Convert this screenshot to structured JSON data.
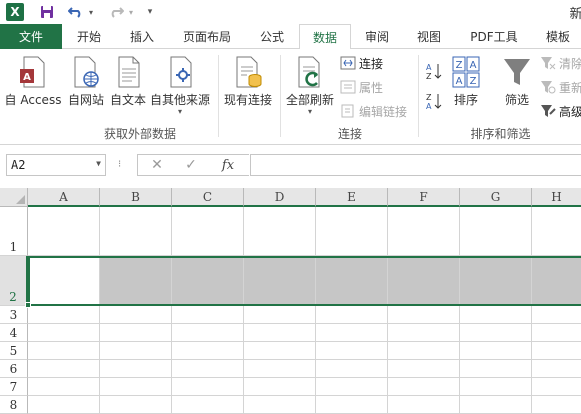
{
  "titlebar": {
    "app_logo": "X",
    "title_fragment": "新",
    "undo_dropdown": "▾",
    "redo_dropdown": "▾",
    "qat_customize": "▾"
  },
  "tabs": [
    {
      "label": "文件"
    },
    {
      "label": "开始"
    },
    {
      "label": "插入"
    },
    {
      "label": "页面布局"
    },
    {
      "label": "公式"
    },
    {
      "label": "数据"
    },
    {
      "label": "审阅"
    },
    {
      "label": "视图"
    },
    {
      "label": "PDF工具"
    },
    {
      "label": "模板"
    }
  ],
  "ribbon": {
    "external_data": {
      "group_label": "获取外部数据",
      "from_access": "自 Access",
      "from_web": "自网站",
      "from_text": "自文本",
      "from_other": "自其他来源",
      "existing_connections": "现有连接"
    },
    "connections": {
      "group_label": "连接",
      "refresh_all": "全部刷新",
      "connections": "连接",
      "properties": "属性",
      "edit_links": "编辑链接"
    },
    "sort_filter": {
      "group_label": "排序和筛选",
      "sort": "排序",
      "filter": "筛选",
      "clear": "清除",
      "reapply": "重新",
      "advanced": "高级"
    }
  },
  "formula_bar": {
    "name_box_value": "A2",
    "cancel_symbol": "✕",
    "enter_symbol": "✓",
    "fx_label": "fx",
    "formula_value": ""
  },
  "grid": {
    "columns": [
      "A",
      "B",
      "C",
      "D",
      "E",
      "F",
      "G",
      "H"
    ],
    "rows": [
      "1",
      "2",
      "3",
      "4",
      "5",
      "6",
      "7",
      "8"
    ],
    "selected_row": "2",
    "active_cell": "A2"
  },
  "colors": {
    "accent": "#217346",
    "selection_fill": "#c6c6c6"
  }
}
